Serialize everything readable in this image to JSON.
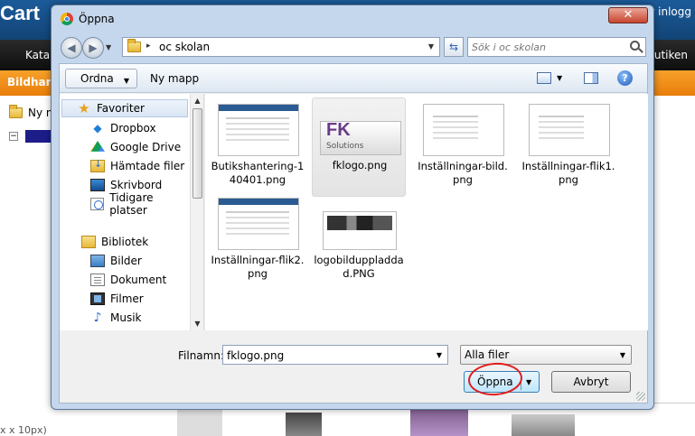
{
  "background": {
    "logo": "Cart",
    "user_text": "är inlogg",
    "nav_left": "Katal",
    "nav_right": "putiken",
    "section_title": "Bildhant",
    "new_folder": "Ny m",
    "footer_text": "x x 10px)"
  },
  "dialog": {
    "title": "Öppna",
    "close_label": "✕",
    "address": {
      "path": "oc skolan"
    },
    "search": {
      "placeholder": "Sök i oc skolan"
    },
    "toolbar": {
      "organize_label": "Ordna",
      "new_folder_label": "Ny mapp",
      "help_label": "?"
    },
    "nav": {
      "favorites": [
        {
          "label": "Favoriter",
          "icon": "star-icon"
        },
        {
          "label": "Dropbox",
          "icon": "dropbox-icon"
        },
        {
          "label": "Google Drive",
          "icon": "google-drive-icon"
        },
        {
          "label": "Hämtade filer",
          "icon": "downloads-icon"
        },
        {
          "label": "Skrivbord",
          "icon": "desktop-icon"
        },
        {
          "label": "Tidigare platser",
          "icon": "recent-places-icon"
        }
      ],
      "libraries": [
        {
          "label": "Bibliotek",
          "icon": "libraries-icon"
        },
        {
          "label": "Bilder",
          "icon": "pictures-icon"
        },
        {
          "label": "Dokument",
          "icon": "documents-icon"
        },
        {
          "label": "Filmer",
          "icon": "videos-icon"
        },
        {
          "label": "Musik",
          "icon": "music-icon"
        }
      ]
    },
    "files": [
      {
        "name": "Butikshantering-140401.png"
      },
      {
        "name": "fklogo.png",
        "selected": true,
        "thumb_text": "FK",
        "thumb_sub": "Solutions"
      },
      {
        "name": "Inställningar-bild.png"
      },
      {
        "name": "Inställningar-flik1.png"
      },
      {
        "name": "Inställningar-flik2.png"
      },
      {
        "name": "logobilduppladdad.PNG"
      }
    ],
    "filename_label": "Filnamn:",
    "filename_value": "fklogo.png",
    "filter_value": "Alla filer",
    "open_label": "Öppna",
    "cancel_label": "Avbryt",
    "highlight_color": "#e21d1d"
  }
}
